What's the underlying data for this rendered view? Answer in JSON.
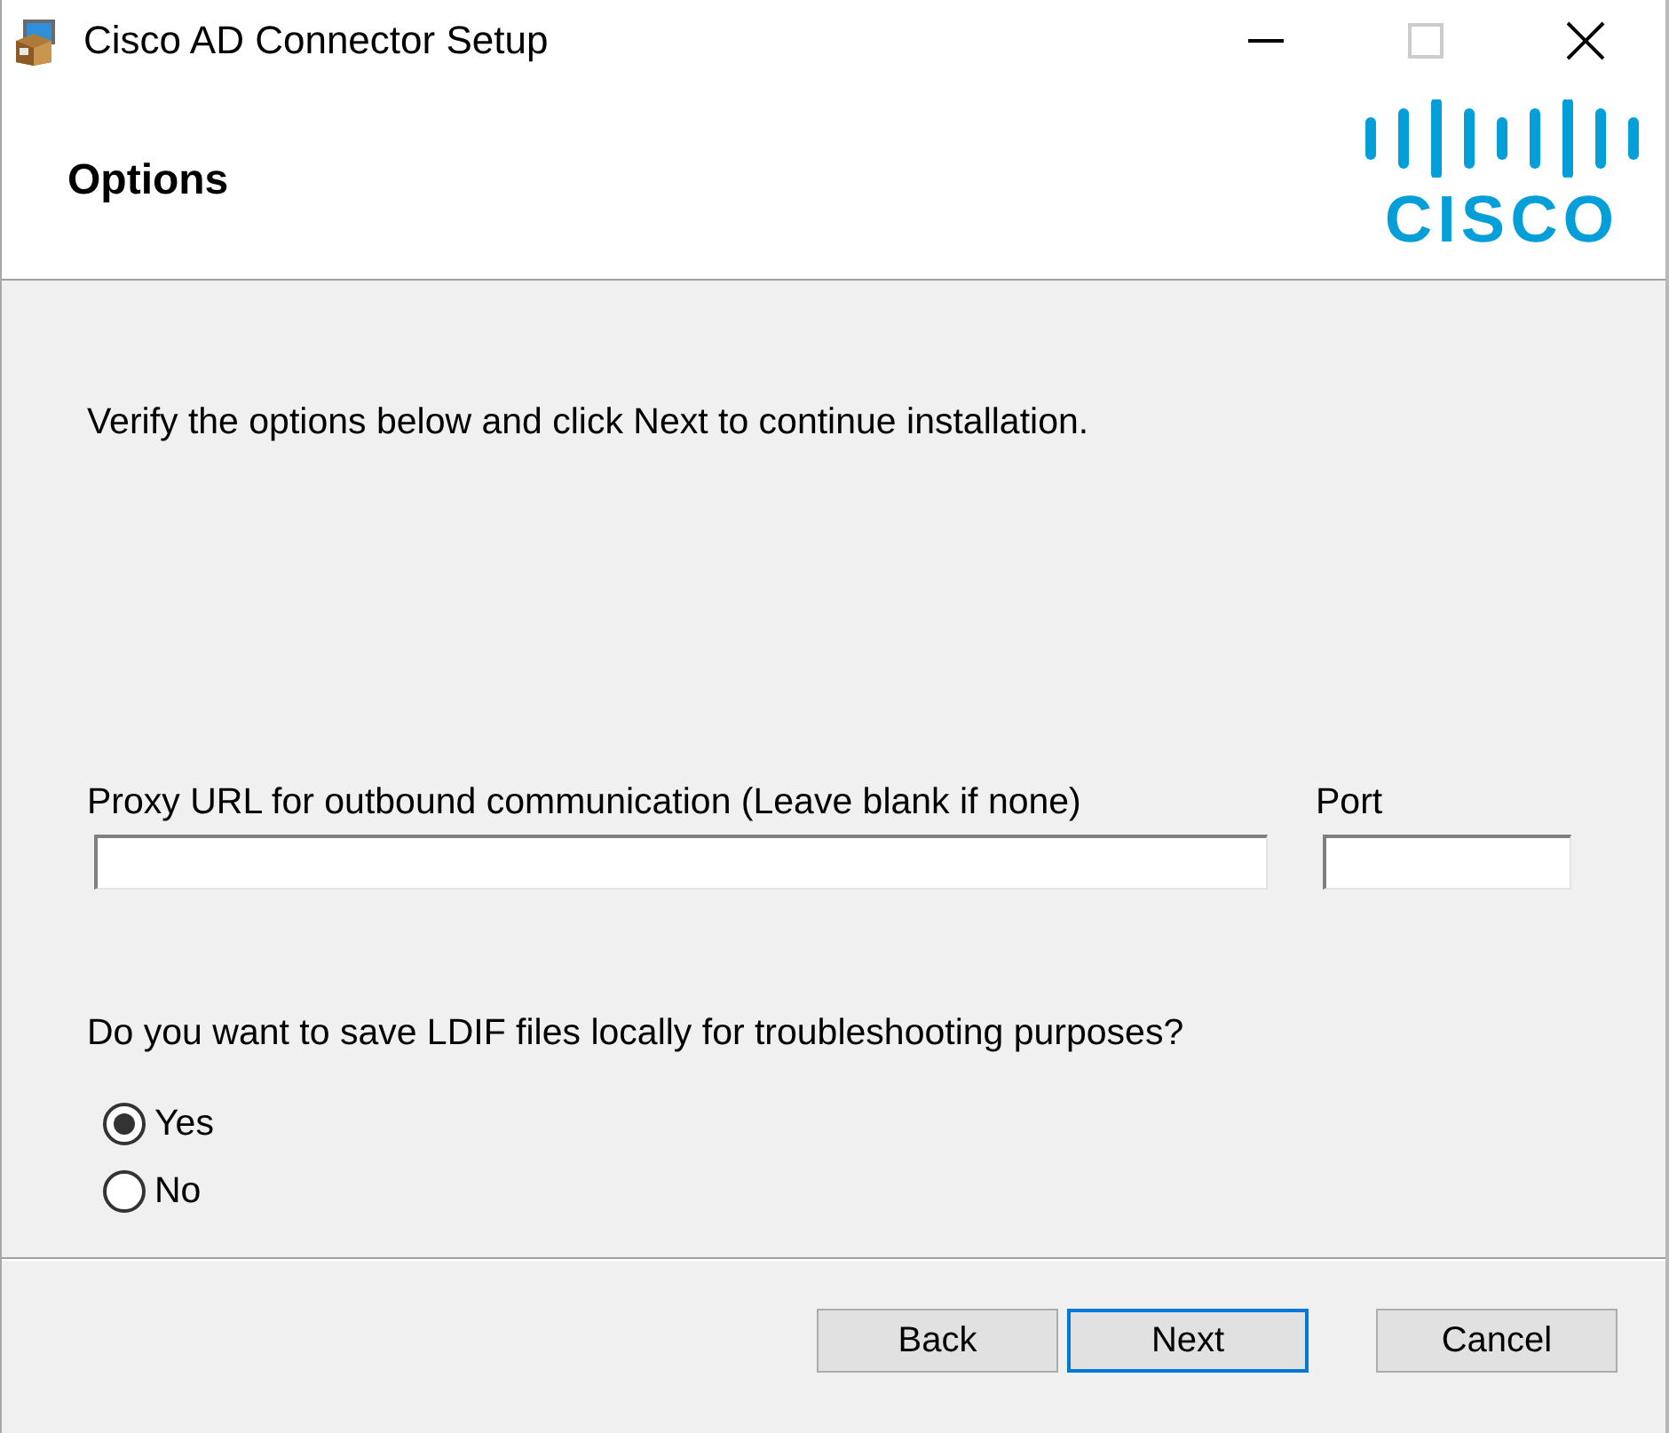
{
  "window": {
    "title": "Cisco AD Connector Setup",
    "maximize_disabled": true
  },
  "header": {
    "title": "Options",
    "logo_text": "CISCO"
  },
  "intro": "Verify the options below and click Next to continue installation.",
  "proxy_url": {
    "label": "Proxy URL for outbound communication (Leave blank if none)"
  },
  "port": {
    "label": "Port"
  },
  "ldif": {
    "question": "Do you want to save LDIF files locally for troubleshooting purposes?",
    "options": [
      {
        "label": "Yes",
        "selected": true
      },
      {
        "label": "No",
        "selected": false
      }
    ]
  },
  "buttons": [
    {
      "label": "Back",
      "focused": false
    },
    {
      "label": "Next",
      "focused": true
    },
    {
      "label": "Cancel",
      "focused": false
    }
  ]
}
